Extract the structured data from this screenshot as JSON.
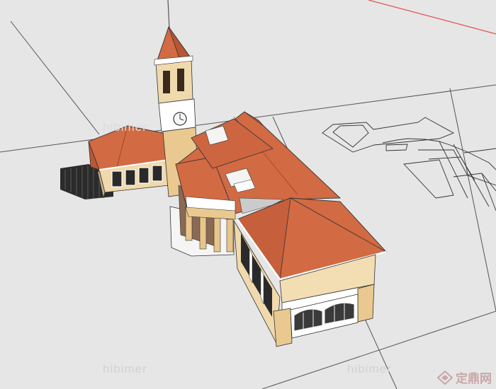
{
  "clock": {
    "face_label": "clock-face"
  },
  "watermarks": {
    "left": "hibimer",
    "right": "hibimer",
    "top": "hibimer"
  },
  "brand": {
    "text": "定鼎网"
  },
  "colors": {
    "ground": "#e6e6e6",
    "roof": "#d26a43",
    "wall": "#f3ddb3",
    "trim": "#ffffff",
    "axis_red": "#e05050"
  }
}
